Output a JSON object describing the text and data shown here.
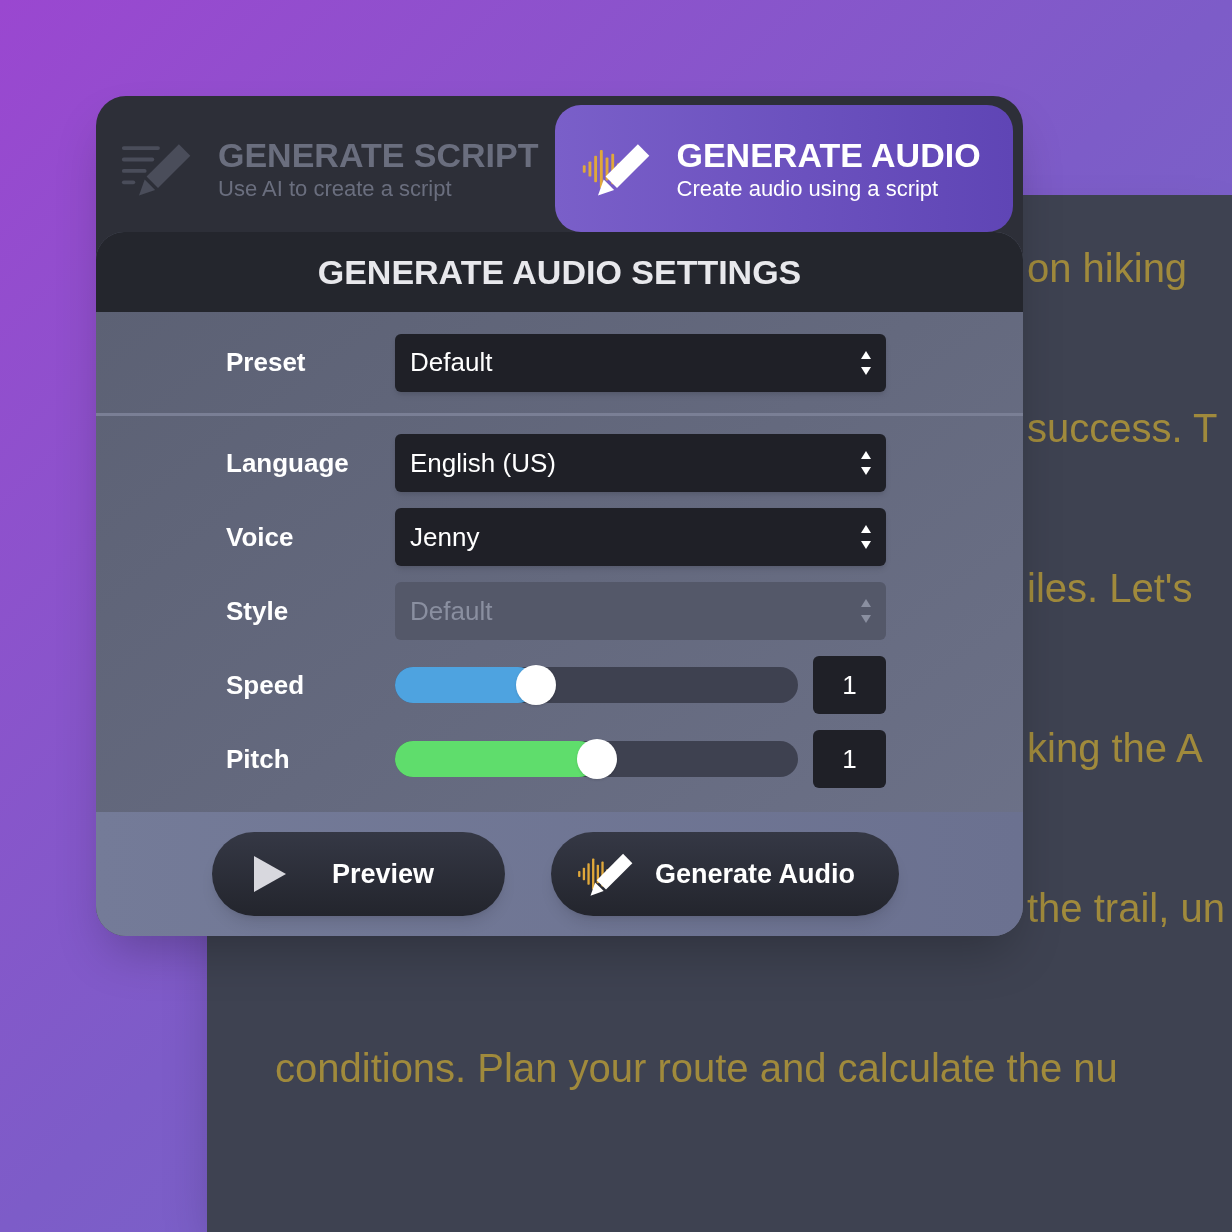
{
  "background_document": {
    "lines": [
      "on hiking",
      "success. T",
      "iles. Let's",
      "king the A",
      "the trail, un",
      "conditions. Plan your route and calculate the nu"
    ]
  },
  "tabs": [
    {
      "title": "GENERATE SCRIPT",
      "subtitle": "Use AI to create a script",
      "selected": false,
      "kind": "script"
    },
    {
      "title": "GENERATE AUDIO",
      "subtitle": "Create audio using a script",
      "selected": true,
      "kind": "audio"
    }
  ],
  "settings": {
    "title": "GENERATE AUDIO SETTINGS",
    "preset": {
      "label": "Preset",
      "value": "Default",
      "disabled": false
    },
    "fields": [
      {
        "kind": "select",
        "label": "Language",
        "value": "English (US)",
        "disabled": false
      },
      {
        "kind": "select",
        "label": "Voice",
        "value": "Jenny",
        "disabled": false
      },
      {
        "kind": "select",
        "label": "Style",
        "value": "Default",
        "disabled": true
      },
      {
        "kind": "slider",
        "label": "Speed",
        "level": 0.35,
        "color": "#4ea3e0",
        "reading": "1"
      },
      {
        "kind": "slider",
        "label": "Pitch",
        "level": 0.5,
        "color": "#5fdd6c",
        "reading": "1"
      }
    ]
  },
  "buttons": [
    {
      "label": "Preview",
      "kind": "play"
    },
    {
      "label": "Generate Audio",
      "kind": "audio"
    }
  ]
}
